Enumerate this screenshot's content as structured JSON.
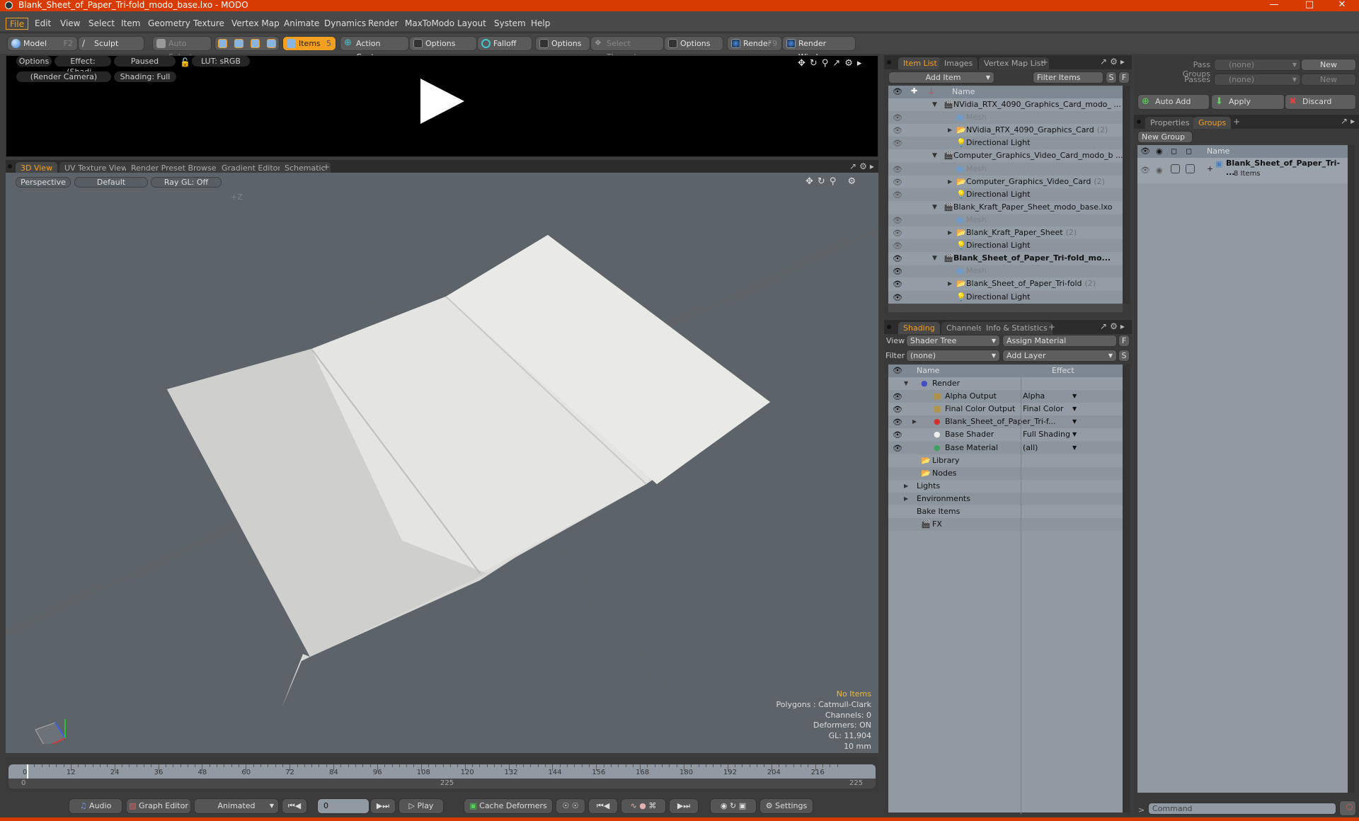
{
  "window": {
    "title": "Blank_Sheet_of_Paper_Tri-fold_modo_base.lxo - MODO",
    "controls": [
      "minimize",
      "maximize",
      "close"
    ]
  },
  "menu": [
    "File",
    "Edit",
    "View",
    "Select",
    "Item",
    "Geometry",
    "Texture",
    "Vertex Map",
    "Animate",
    "Dynamics",
    "Render",
    "MaxToModo",
    "Layout",
    "System",
    "Help"
  ],
  "toolbar": {
    "model": "Model",
    "model_key": "F2",
    "sculpt": "Sculpt",
    "auto_select": "Auto Select",
    "items": "Items",
    "items_key": "5",
    "action_center": "Action Center",
    "options1": "Options",
    "falloff": "Falloff",
    "options2": "Options",
    "select_through": "Select Through",
    "options3": "Options",
    "render": "Render",
    "render_key": "F9",
    "render_window": "Render Window"
  },
  "render_view": {
    "options": "Options",
    "effect": "Effect: (Shadi...",
    "paused": "Paused",
    "lut": "LUT: sRGB",
    "camera": "(Render Camera)",
    "shading": "Shading: Full"
  },
  "viewport_tabs": [
    "3D View",
    "UV Texture View",
    "Render Preset Browser",
    "Gradient Editor",
    "Schematic"
  ],
  "viewport": {
    "projection": "Perspective",
    "style": "Default",
    "raygl": "Ray GL: Off",
    "axis_label": "+Z",
    "stats": {
      "selection": "No Items",
      "polygons": "Polygons : Catmull-Clark",
      "channels": "Channels: 0",
      "deformers": "Deformers: ON",
      "gl": "GL: 11,904",
      "scale": "10 mm"
    },
    "colors": {
      "selection": "#f3b830",
      "paper": "#e4e4e2",
      "bg": "#5c646a"
    }
  },
  "timeline": {
    "ticks": [
      "0",
      "12",
      "24",
      "36",
      "48",
      "60",
      "72",
      "84",
      "96",
      "108",
      "120",
      "132",
      "144",
      "156",
      "168",
      "180",
      "192",
      "204",
      "216"
    ],
    "range_start": "0",
    "range_mid": "225",
    "range_end": "225",
    "current_frame": 0,
    "max_frame": 225
  },
  "bottombar": {
    "audio": "Audio",
    "graph_editor": "Graph Editor",
    "animated": "Animated",
    "frame": "0",
    "play": "Play",
    "cache_deformers": "Cache Deformers",
    "settings": "Settings"
  },
  "item_list": {
    "tabs": [
      "Item List",
      "Images",
      "Vertex Map List"
    ],
    "add_item": "Add Item",
    "filter": "Filter Items",
    "s": "S",
    "f": "F",
    "header_name": "Name",
    "rows": [
      {
        "label": "NVidia_RTX_4090_Graphics_Card_modo_ ...",
        "type": "scene",
        "indent": 0,
        "eye": "none"
      },
      {
        "label": "Mesh",
        "type": "mesh",
        "indent": 1,
        "eye": "dim"
      },
      {
        "label": "NVidia_RTX_4090_Graphics_Card",
        "count": "(2)",
        "type": "group",
        "indent": 1,
        "eye": "dim"
      },
      {
        "label": "Directional Light",
        "type": "light",
        "indent": 1,
        "eye": "dim"
      },
      {
        "label": "Computer_Graphics_Video_Card_modo_b ...",
        "type": "scene",
        "indent": 0,
        "eye": "none"
      },
      {
        "label": "Mesh",
        "type": "mesh",
        "indent": 1,
        "eye": "dim"
      },
      {
        "label": "Computer_Graphics_Video_Card",
        "count": "(2)",
        "type": "group",
        "indent": 1,
        "eye": "dim"
      },
      {
        "label": "Directional Light",
        "type": "light",
        "indent": 1,
        "eye": "dim"
      },
      {
        "label": "Blank_Kraft_Paper_Sheet_modo_base.lxo",
        "type": "scene",
        "indent": 0,
        "eye": "none"
      },
      {
        "label": "Mesh",
        "type": "mesh",
        "indent": 1,
        "eye": "dim"
      },
      {
        "label": "Blank_Kraft_Paper_Sheet",
        "count": "(2)",
        "type": "group",
        "indent": 1,
        "eye": "dim"
      },
      {
        "label": "Directional Light",
        "type": "light",
        "indent": 1,
        "eye": "dim"
      },
      {
        "label": "Blank_Sheet_of_Paper_Tri-fold_mo...",
        "type": "scene",
        "indent": 0,
        "eye": "on",
        "bold": true
      },
      {
        "label": "Mesh",
        "type": "mesh",
        "indent": 1,
        "eye": "on"
      },
      {
        "label": "Blank_Sheet_of_Paper_Tri-fold",
        "count": "(2)",
        "type": "group",
        "indent": 1,
        "eye": "on"
      },
      {
        "label": "Directional Light",
        "type": "light",
        "indent": 1,
        "eye": "on"
      }
    ]
  },
  "shading": {
    "tabs": [
      "Shading",
      "Channels",
      "Info & Statistics"
    ],
    "view_label": "View",
    "view_value": "Shader Tree",
    "assign_material": "Assign Material",
    "filter_label": "Filter",
    "filter_value": "(none)",
    "add_layer": "Add Layer",
    "f": "F",
    "s": "S",
    "header_name": "Name",
    "header_effect": "Effect",
    "rows": [
      {
        "label": "Render",
        "effect": "",
        "indent": 0,
        "icon": "render",
        "eye": false,
        "expand": "open"
      },
      {
        "label": "Alpha Output",
        "effect": "Alpha",
        "indent": 1,
        "icon": "output",
        "eye": true
      },
      {
        "label": "Final Color Output",
        "effect": "Final Color",
        "indent": 1,
        "icon": "output",
        "eye": true
      },
      {
        "label": "Blank_Sheet_of_Paper_Tri-f...",
        "effect": "",
        "indent": 1,
        "icon": "material-group",
        "eye": true,
        "expand": "closed"
      },
      {
        "label": "Base Shader",
        "effect": "Full Shading",
        "indent": 1,
        "icon": "shader",
        "eye": true
      },
      {
        "label": "Base Material",
        "effect": "(all)",
        "indent": 1,
        "icon": "material",
        "eye": true
      },
      {
        "label": "Library",
        "effect": null,
        "indent": 0,
        "icon": "folder"
      },
      {
        "label": "Nodes",
        "effect": null,
        "indent": 0,
        "icon": "folder"
      },
      {
        "label": "Lights",
        "effect": null,
        "indent": -1,
        "icon": "none",
        "expand": "closed"
      },
      {
        "label": "Environments",
        "effect": null,
        "indent": -1,
        "icon": "none",
        "expand": "closed"
      },
      {
        "label": "Bake Items",
        "effect": null,
        "indent": -1,
        "icon": "none"
      },
      {
        "label": "FX",
        "effect": null,
        "indent": 0,
        "icon": "fx"
      }
    ]
  },
  "passes": {
    "pass_groups_label": "Pass Groups",
    "pass_groups_value": "(none)",
    "new1": "New",
    "passes_label": "Passes",
    "passes_value": "(none)",
    "new2": "New",
    "auto_add": "Auto Add",
    "apply": "Apply",
    "discard": "Discard"
  },
  "groups": {
    "tabs": [
      "Properties",
      "Groups"
    ],
    "new_group": "New Group",
    "header_name": "Name",
    "group_name": "Blank_Sheet_of_Paper_Tri- ...",
    "group_count": "8 Items"
  },
  "command": {
    "prompt": ">",
    "placeholder": "Command"
  },
  "accent": "#f3a020"
}
